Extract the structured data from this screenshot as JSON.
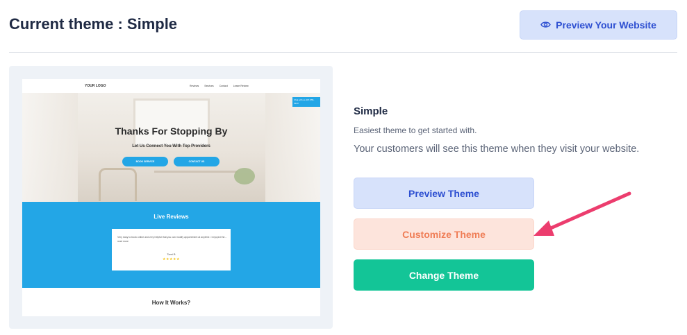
{
  "header": {
    "title": "Current theme : Simple",
    "preview_website_label": "Preview Your Website",
    "preview_website_icon": "eye-icon"
  },
  "thumbnail": {
    "logo": "YOUR LOGO",
    "nav_links": [
      "Reviews",
      "Services",
      "Contact",
      "Leave Review"
    ],
    "badge": "Chat with us 407-555-0123",
    "hero_title": "Thanks For Stopping By",
    "hero_subtitle": "Let Us Connect You With Top Providers",
    "hero_button_1": "BOOK SERVICE",
    "hero_button_2": "CONTACT US",
    "reviews_title": "Live Reviews",
    "review_text": "Very easy to book online and very helpful that you can modify appointment at anytime. I enjoyed the... read more",
    "review_author": "Tami B",
    "review_stars": "★★★★★",
    "how_title": "How It Works?"
  },
  "theme": {
    "name": "Simple",
    "description": "Easiest theme to get started with.",
    "note": "Your customers will see this theme when they visit your website."
  },
  "actions": {
    "preview_theme": "Preview Theme",
    "customize_theme": "Customize Theme",
    "change_theme": "Change Theme"
  },
  "colors": {
    "accent_blue": "#2d4fd1",
    "preview_bg": "#d7e2fb",
    "customize_bg": "#fde4dc",
    "customize_text": "#ef7d56",
    "change_bg": "#13c597",
    "annotation_arrow": "#ec3d6e",
    "site_blue": "#23a6e6"
  }
}
